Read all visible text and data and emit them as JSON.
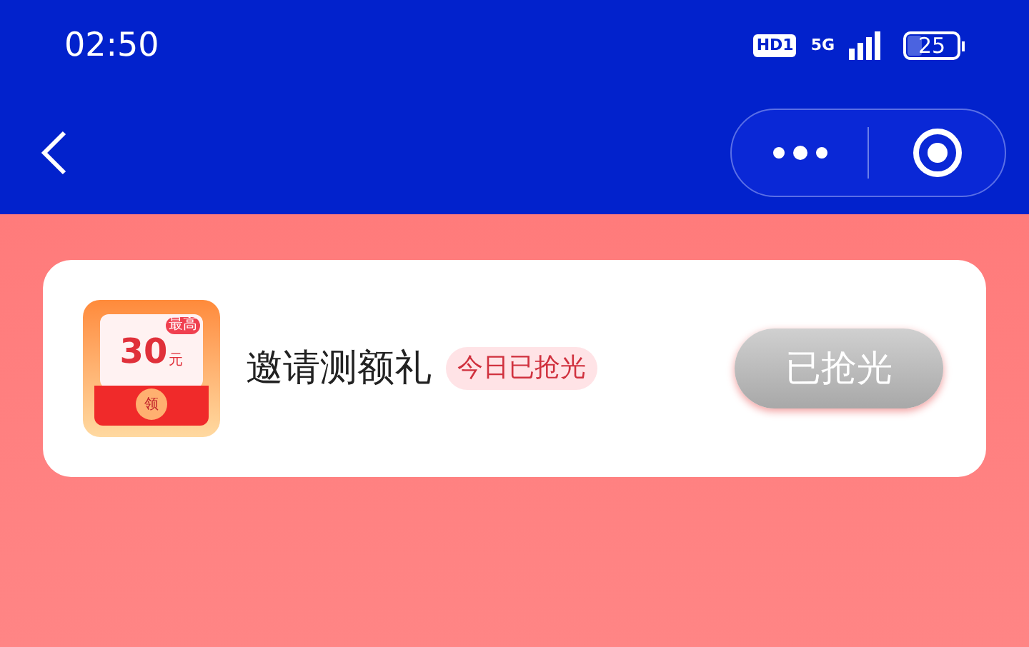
{
  "status_bar": {
    "time": "02:50",
    "hd_badge": "HD1",
    "network": "5G",
    "battery": "25"
  },
  "offer": {
    "icon": {
      "amount": "30",
      "unit": "元",
      "tag": "最高",
      "seal": "领"
    },
    "title": "邀请测额礼",
    "badge": "今日已抢光",
    "button": {
      "label": "已抢光",
      "disabled": true
    }
  }
}
